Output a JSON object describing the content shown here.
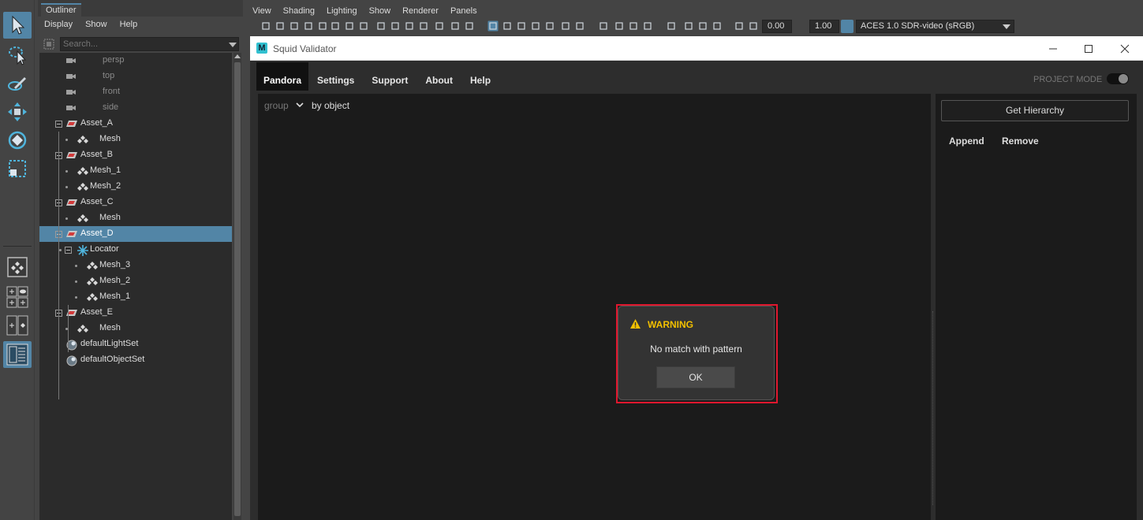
{
  "outliner": {
    "tab_label": "Outliner",
    "menu": [
      "Display",
      "Show",
      "Help"
    ],
    "search_placeholder": "Search...",
    "tree": [
      {
        "label": "persp",
        "kind": "camera",
        "dim": true
      },
      {
        "label": "top",
        "kind": "camera",
        "dim": true
      },
      {
        "label": "front",
        "kind": "camera",
        "dim": true
      },
      {
        "label": "side",
        "kind": "camera",
        "dim": true
      },
      {
        "label": "Asset_A",
        "kind": "asset"
      },
      {
        "label": "Mesh",
        "kind": "mesh"
      },
      {
        "label": "Asset_B",
        "kind": "asset"
      },
      {
        "label": "Mesh_1",
        "kind": "mesh"
      },
      {
        "label": "Mesh_2",
        "kind": "mesh"
      },
      {
        "label": "Asset_C",
        "kind": "asset"
      },
      {
        "label": "Mesh",
        "kind": "mesh"
      },
      {
        "label": "Asset_D",
        "kind": "asset",
        "selected": true
      },
      {
        "label": "Locator",
        "kind": "locator"
      },
      {
        "label": "Mesh_3",
        "kind": "mesh"
      },
      {
        "label": "Mesh_2",
        "kind": "mesh"
      },
      {
        "label": "Mesh_1",
        "kind": "mesh"
      },
      {
        "label": "Asset_E",
        "kind": "asset"
      },
      {
        "label": "Mesh",
        "kind": "mesh"
      },
      {
        "label": "defaultLightSet",
        "kind": "set"
      },
      {
        "label": "defaultObjectSet",
        "kind": "set"
      }
    ]
  },
  "viewport": {
    "menu": [
      "View",
      "Shading",
      "Lighting",
      "Show",
      "Renderer",
      "Panels"
    ],
    "exposure": "0.00",
    "gamma": "1.00",
    "color_space": "ACES 1.0 SDR-video (sRGB)"
  },
  "validator": {
    "window_title": "Squid Validator",
    "logo_letter": "M",
    "tabs": [
      "Pandora",
      "Settings",
      "Support",
      "About",
      "Help"
    ],
    "project_mode_label": "PROJECT MODE",
    "group_label": "group",
    "group_value": "by object",
    "get_hierarchy_label": "Get Hierarchy",
    "append_label": "Append",
    "remove_label": "Remove"
  },
  "warning": {
    "title": "WARNING",
    "message": "No match with pattern",
    "ok_label": "OK"
  },
  "colors": {
    "accent": "#5285a6",
    "warning_title": "#f2c000",
    "highlight_frame": "#e0172e"
  }
}
